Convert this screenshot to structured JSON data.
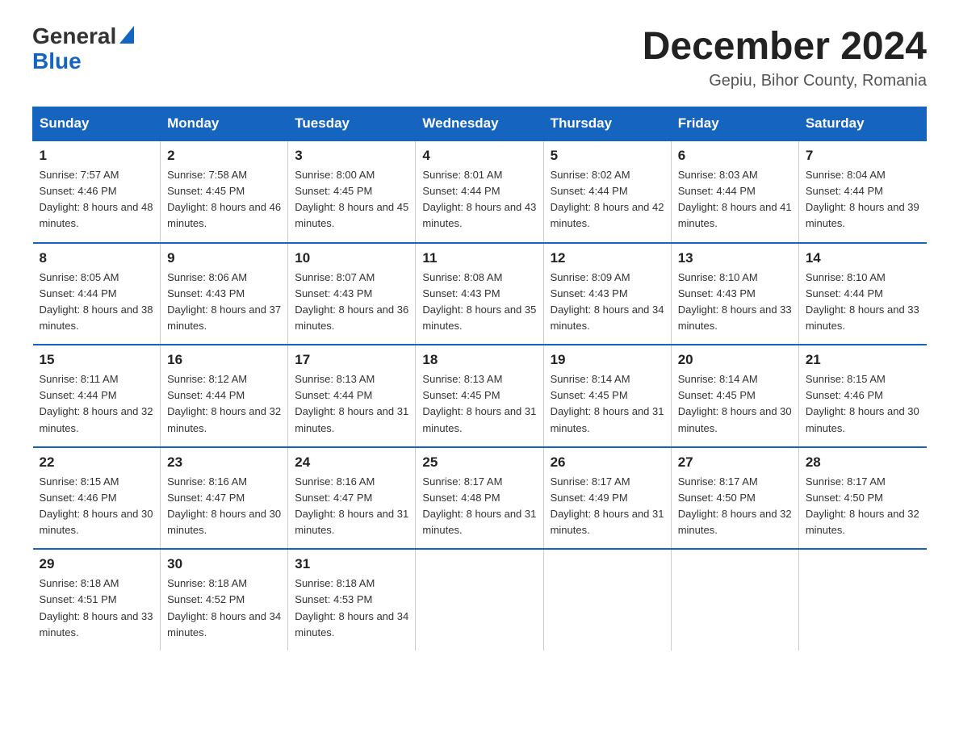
{
  "header": {
    "logo_general": "General",
    "logo_blue": "Blue",
    "month_title": "December 2024",
    "location": "Gepiu, Bihor County, Romania"
  },
  "days_of_week": [
    "Sunday",
    "Monday",
    "Tuesday",
    "Wednesday",
    "Thursday",
    "Friday",
    "Saturday"
  ],
  "weeks": [
    [
      {
        "day": "1",
        "sunrise": "7:57 AM",
        "sunset": "4:46 PM",
        "daylight": "8 hours and 48 minutes."
      },
      {
        "day": "2",
        "sunrise": "7:58 AM",
        "sunset": "4:45 PM",
        "daylight": "8 hours and 46 minutes."
      },
      {
        "day": "3",
        "sunrise": "8:00 AM",
        "sunset": "4:45 PM",
        "daylight": "8 hours and 45 minutes."
      },
      {
        "day": "4",
        "sunrise": "8:01 AM",
        "sunset": "4:44 PM",
        "daylight": "8 hours and 43 minutes."
      },
      {
        "day": "5",
        "sunrise": "8:02 AM",
        "sunset": "4:44 PM",
        "daylight": "8 hours and 42 minutes."
      },
      {
        "day": "6",
        "sunrise": "8:03 AM",
        "sunset": "4:44 PM",
        "daylight": "8 hours and 41 minutes."
      },
      {
        "day": "7",
        "sunrise": "8:04 AM",
        "sunset": "4:44 PM",
        "daylight": "8 hours and 39 minutes."
      }
    ],
    [
      {
        "day": "8",
        "sunrise": "8:05 AM",
        "sunset": "4:44 PM",
        "daylight": "8 hours and 38 minutes."
      },
      {
        "day": "9",
        "sunrise": "8:06 AM",
        "sunset": "4:43 PM",
        "daylight": "8 hours and 37 minutes."
      },
      {
        "day": "10",
        "sunrise": "8:07 AM",
        "sunset": "4:43 PM",
        "daylight": "8 hours and 36 minutes."
      },
      {
        "day": "11",
        "sunrise": "8:08 AM",
        "sunset": "4:43 PM",
        "daylight": "8 hours and 35 minutes."
      },
      {
        "day": "12",
        "sunrise": "8:09 AM",
        "sunset": "4:43 PM",
        "daylight": "8 hours and 34 minutes."
      },
      {
        "day": "13",
        "sunrise": "8:10 AM",
        "sunset": "4:43 PM",
        "daylight": "8 hours and 33 minutes."
      },
      {
        "day": "14",
        "sunrise": "8:10 AM",
        "sunset": "4:44 PM",
        "daylight": "8 hours and 33 minutes."
      }
    ],
    [
      {
        "day": "15",
        "sunrise": "8:11 AM",
        "sunset": "4:44 PM",
        "daylight": "8 hours and 32 minutes."
      },
      {
        "day": "16",
        "sunrise": "8:12 AM",
        "sunset": "4:44 PM",
        "daylight": "8 hours and 32 minutes."
      },
      {
        "day": "17",
        "sunrise": "8:13 AM",
        "sunset": "4:44 PM",
        "daylight": "8 hours and 31 minutes."
      },
      {
        "day": "18",
        "sunrise": "8:13 AM",
        "sunset": "4:45 PM",
        "daylight": "8 hours and 31 minutes."
      },
      {
        "day": "19",
        "sunrise": "8:14 AM",
        "sunset": "4:45 PM",
        "daylight": "8 hours and 31 minutes."
      },
      {
        "day": "20",
        "sunrise": "8:14 AM",
        "sunset": "4:45 PM",
        "daylight": "8 hours and 30 minutes."
      },
      {
        "day": "21",
        "sunrise": "8:15 AM",
        "sunset": "4:46 PM",
        "daylight": "8 hours and 30 minutes."
      }
    ],
    [
      {
        "day": "22",
        "sunrise": "8:15 AM",
        "sunset": "4:46 PM",
        "daylight": "8 hours and 30 minutes."
      },
      {
        "day": "23",
        "sunrise": "8:16 AM",
        "sunset": "4:47 PM",
        "daylight": "8 hours and 30 minutes."
      },
      {
        "day": "24",
        "sunrise": "8:16 AM",
        "sunset": "4:47 PM",
        "daylight": "8 hours and 31 minutes."
      },
      {
        "day": "25",
        "sunrise": "8:17 AM",
        "sunset": "4:48 PM",
        "daylight": "8 hours and 31 minutes."
      },
      {
        "day": "26",
        "sunrise": "8:17 AM",
        "sunset": "4:49 PM",
        "daylight": "8 hours and 31 minutes."
      },
      {
        "day": "27",
        "sunrise": "8:17 AM",
        "sunset": "4:50 PM",
        "daylight": "8 hours and 32 minutes."
      },
      {
        "day": "28",
        "sunrise": "8:17 AM",
        "sunset": "4:50 PM",
        "daylight": "8 hours and 32 minutes."
      }
    ],
    [
      {
        "day": "29",
        "sunrise": "8:18 AM",
        "sunset": "4:51 PM",
        "daylight": "8 hours and 33 minutes."
      },
      {
        "day": "30",
        "sunrise": "8:18 AM",
        "sunset": "4:52 PM",
        "daylight": "8 hours and 34 minutes."
      },
      {
        "day": "31",
        "sunrise": "8:18 AM",
        "sunset": "4:53 PM",
        "daylight": "8 hours and 34 minutes."
      },
      null,
      null,
      null,
      null
    ]
  ]
}
